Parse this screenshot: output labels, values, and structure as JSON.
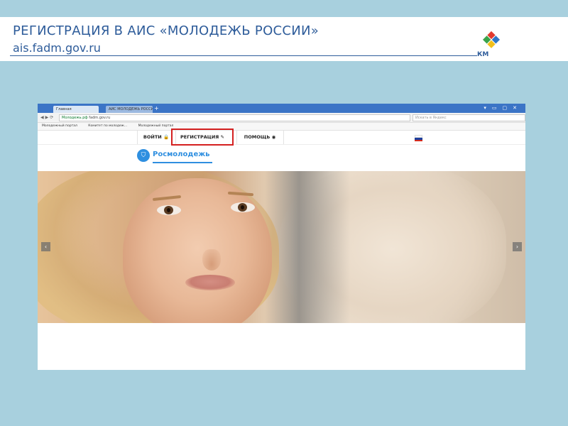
{
  "slide": {
    "title": "РЕГИСТРАЦИЯ В АИС «МОЛОДЕЖЬ РОССИИ»",
    "subtitle": "ais.fadm.gov.ru",
    "logo_text": "КМ",
    "colors": {
      "background": "#a8d0de",
      "accent": "#2e5c9a",
      "highlight": "#d42020"
    }
  },
  "browser": {
    "tabs": [
      {
        "label": "Главная"
      },
      {
        "label": "АИС МОЛОДЕЖЬ РОССИ"
      }
    ],
    "url_domain": "Молодежь.рф",
    "url": "fadm.gov.ru",
    "search_placeholder": "Искать в Яндекс",
    "bookmarks": [
      "Молодежный портал",
      "Комитет по молодеж...",
      "Молодежный портал"
    ]
  },
  "site": {
    "nav": {
      "login": "ВОЙТИ",
      "register": "РЕГИСТРАЦИЯ",
      "help": "ПОМОЩЬ"
    },
    "brand": "Росмолодежь",
    "slider": {
      "prev_icon": "chevron-left-icon",
      "next_icon": "chevron-right-icon"
    },
    "language_flag": [
      "#ffffff",
      "#1c3f9e",
      "#d52b1e"
    ]
  }
}
